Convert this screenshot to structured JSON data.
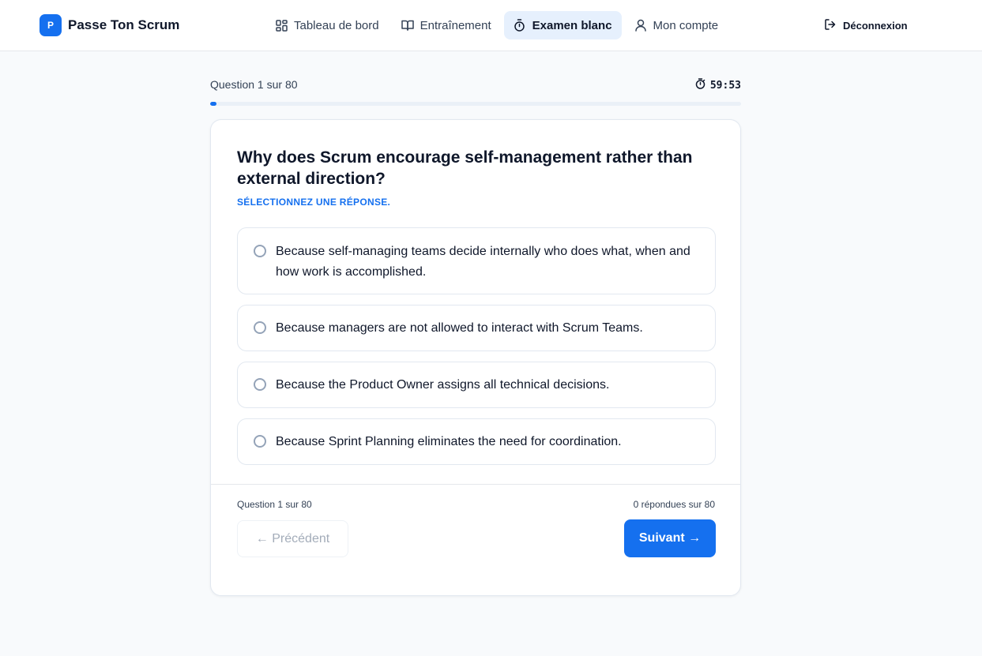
{
  "app": {
    "logo_letter": "P",
    "name": "Passe Ton Scrum"
  },
  "nav": {
    "items": [
      {
        "label": "Tableau de bord",
        "icon": "dashboard-grid-icon",
        "active": false
      },
      {
        "label": "Entraînement",
        "icon": "book-icon",
        "active": false
      },
      {
        "label": "Examen blanc",
        "icon": "stopwatch-icon",
        "active": true
      },
      {
        "label": "Mon compte",
        "icon": "user-icon",
        "active": false
      }
    ],
    "logout_label": "Déconnexion"
  },
  "exam": {
    "progress_label": "Question 1 sur 80",
    "timer": "59:53",
    "progress_fraction": 0.0125,
    "question": "Why does Scrum encourage self-management rather than external direction?",
    "instruction": "SÉLECTIONNEZ UNE RÉPONSE.",
    "options": [
      "Because self-managing teams decide internally who does what, when and how work is accomplished.",
      "Because managers are not allowed to interact with Scrum Teams.",
      "Because the Product Owner assigns all technical decisions.",
      "Because Sprint Planning eliminates the need for coordination."
    ],
    "footer_question": "Question 1 sur 80",
    "footer_answered": "0 répondues sur 80",
    "prev_label": "← Précédent",
    "next_label": "Suivant →"
  },
  "colors": {
    "accent": "#1570ef",
    "active_nav_bg": "#e6f0fd",
    "page_bg": "#f8fafc"
  }
}
